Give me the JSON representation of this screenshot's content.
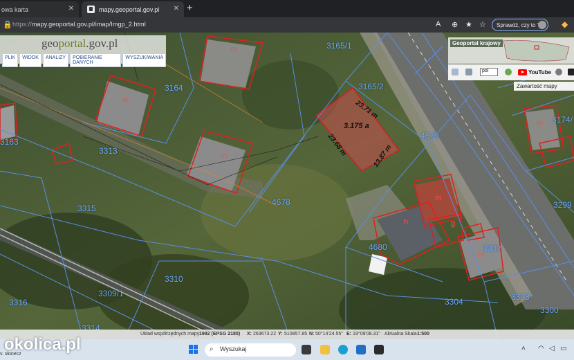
{
  "browser": {
    "tabs": [
      {
        "label": "owa karta",
        "active": false
      },
      {
        "label": "mapy.geoportal.gov.pl",
        "active": true
      }
    ],
    "url": {
      "protocol": "https://",
      "rest": "mapy.geoportal.gov.pl/imap/Imgp_2.html"
    },
    "sprawdz_label": "Sprawdź, czy to Ty"
  },
  "geoportal": {
    "logo_prefix": "geo",
    "logo_main": "portal",
    "logo_suffix": ".gov.pl",
    "menu": [
      "PLIK",
      "WIDOK",
      "ANALIZY",
      "POBIERANIE DANYCH",
      "WYSZUKIWANIA"
    ],
    "krajowy_title": "Geoportal krajowy",
    "lang_select": "pol",
    "youtube_label": "YouTube",
    "content_button": "Zawartość mapy"
  },
  "map": {
    "parcel_numbers": [
      "3165/1",
      "3165/2",
      "3164",
      "4679",
      "3174/",
      "3163",
      "3313",
      "4678",
      "3299",
      "3315",
      "4680",
      "3302",
      "3310",
      "3304",
      "3303",
      "3316",
      "3300",
      "3314",
      "3309/1"
    ],
    "building_letters": [
      "m",
      "m",
      "m",
      "m",
      "m",
      "h",
      "g",
      "m"
    ],
    "plot_area": "3.175 a",
    "dimensions": [
      "23.71 m",
      "23.68 m",
      "13.87 m"
    ]
  },
  "statusbar": {
    "uklad": "Układ współrzędnych mapy",
    "uklad_value": "1992 (EPSG 2180)",
    "x_label": "X:",
    "x_value": "263673.22",
    "y_label": "Y:",
    "y_value": "510857.85",
    "n_label": "N:",
    "n_value": "50°14'24.55\"",
    "e_label": "E:",
    "e_value": "19°09'08.31\"",
    "scale_label": "Aktualna Skala",
    "scale_value": "1:500"
  },
  "taskbar": {
    "brand": "okolica.pl",
    "weather": "v. słonecz",
    "search_placeholder": "Wyszukaj"
  },
  "colors": {
    "parcel_line": "#5a8ee6",
    "building_outline": "#e02020",
    "highlight_fill": "#c0504d"
  }
}
